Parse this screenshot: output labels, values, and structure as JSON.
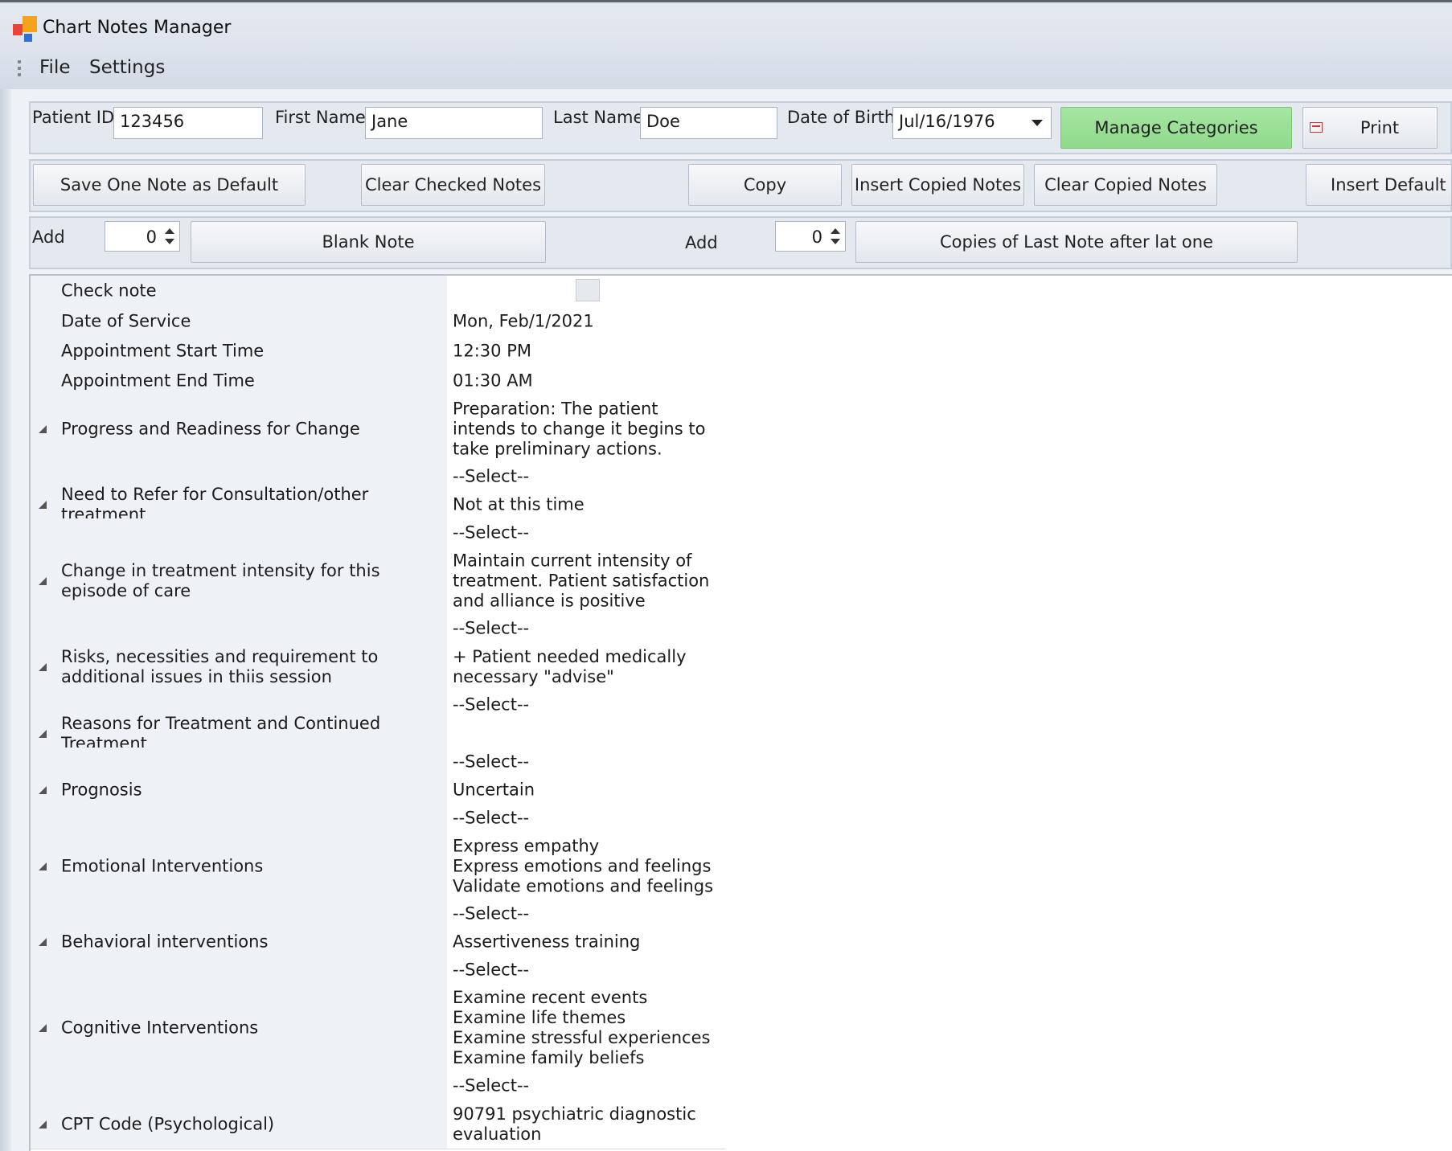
{
  "window": {
    "title": "Chart Notes Manager"
  },
  "menu": {
    "items": [
      "File",
      "Settings"
    ]
  },
  "patient": {
    "patient_id_label": "Patient ID",
    "patient_id": "123456",
    "first_name_label": "First Name",
    "first_name": "Jane",
    "last_name_label": "Last Name",
    "last_name": "Doe",
    "dob_label": "Date of Birth",
    "dob": "Jul/16/1976",
    "manage_categories_label": "Manage Categories",
    "print_label": "Print"
  },
  "toolbar": {
    "save_default_label": "Save One Note as Default",
    "clear_checked_label": "Clear Checked Notes",
    "copy_label": "Copy",
    "insert_copied_label": "Insert Copied Notes",
    "clear_copied_label": "Clear Copied Notes",
    "insert_default_label": "Insert Default N"
  },
  "add_row": {
    "add_label_1": "Add",
    "blank_count": "0",
    "blank_note_label": "Blank Note",
    "add_label_2": "Add",
    "copies_count": "0",
    "copies_label": "Copies of Last Note after lat one"
  },
  "colors": {
    "accent_green": "#9be197",
    "title_bar": "#dde3ec"
  },
  "grid": {
    "rows": [
      {
        "name": "Check note",
        "value": "",
        "checkbox": true
      },
      {
        "name": "Date of Service",
        "value": "Mon, Feb/1/2021"
      },
      {
        "name": "Appointment Start Time",
        "value": "12:30 PM"
      },
      {
        "name": "Appointment End Time",
        "value": "01:30 AM"
      },
      {
        "name": "Progress and Readiness for Change",
        "value": "Preparation: The patient intends to change it begins to take preliminary actions.",
        "expand": true
      },
      {
        "name": "",
        "value": "--Select--"
      },
      {
        "name": "Need to Refer for Consultation/other treatment",
        "value": "Not at this time",
        "expand": true
      },
      {
        "name": "",
        "value": "--Select--"
      },
      {
        "name": "Change in treatment intensity for this episode of care",
        "value": "Maintain current intensity of treatment.  Patient satisfaction and alliance is positive",
        "expand": true
      },
      {
        "name": "",
        "value": "--Select--"
      },
      {
        "name": "Risks, necessities and requirement to additional issues in thiis session",
        "value": "+ Patient needed medically necessary \"advise\"",
        "expand": true
      },
      {
        "name": "",
        "value": "--Select--"
      },
      {
        "name": "Reasons for Treatment and Continued Treatment",
        "value": "",
        "expand": true
      },
      {
        "name": "",
        "value": "--Select--"
      },
      {
        "name": "Prognosis",
        "value": "Uncertain",
        "expand": true
      },
      {
        "name": "",
        "value": "--Select--"
      },
      {
        "name": "Emotional Interventions",
        "value": "Express empathy\nExpress emotions and feelings\nValidate emotions and feelings",
        "expand": true
      },
      {
        "name": "",
        "value": "--Select--"
      },
      {
        "name": "Behavioral interventions",
        "value": "Assertiveness training",
        "expand": true
      },
      {
        "name": "",
        "value": "--Select--"
      },
      {
        "name": "Cognitive Interventions",
        "value": "Examine recent events\nExamine life themes\nExamine stressful experiences\nExamine family beliefs",
        "expand": true
      },
      {
        "name": "",
        "value": "--Select--"
      },
      {
        "name": "CPT Code (Psychological)",
        "value": "90791 psychiatric diagnostic evaluation",
        "expand": true
      }
    ]
  }
}
